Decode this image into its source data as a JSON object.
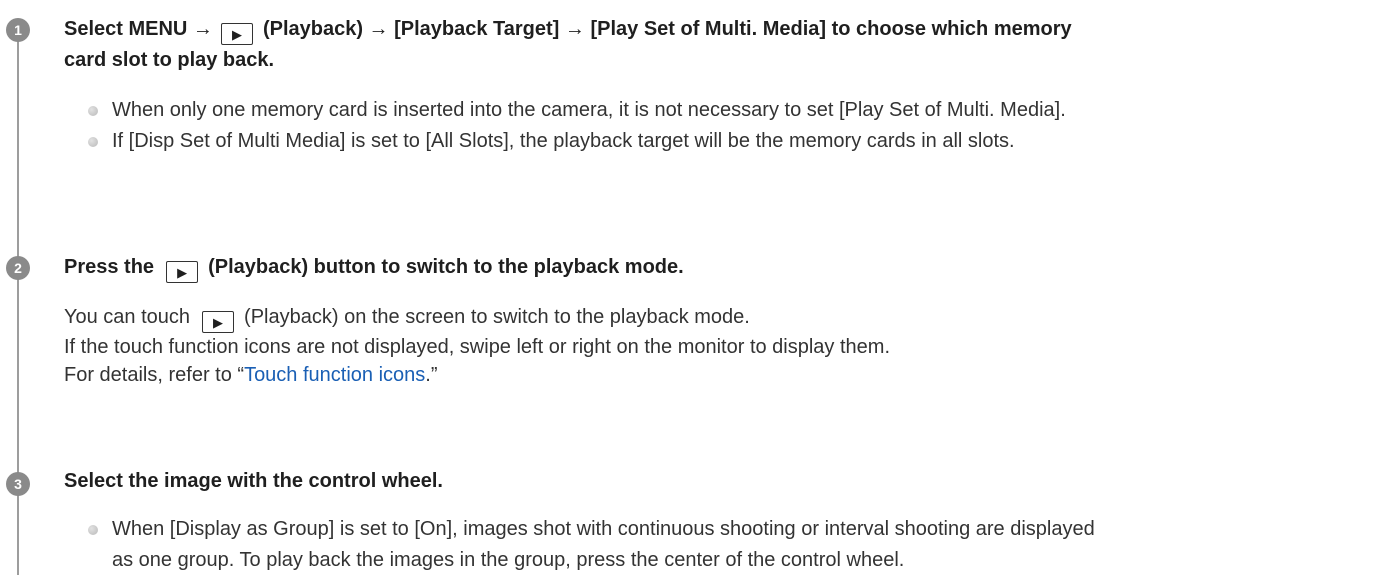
{
  "steps": [
    {
      "number": "1",
      "title_before": "Select MENU →",
      "title_after": "(Playback) → [Playback Target] → [Play Set of Multi. Media] to choose which memory",
      "title_line2": "card slot to play back.",
      "bullets": [
        "When only one memory card is inserted into the camera, it is not necessary to set [Play Set of Multi. Media].",
        "If [Disp Set of Multi Media] is set to [All Slots], the playback target will be the memory cards in all slots."
      ]
    },
    {
      "number": "2",
      "title_before": "Press the",
      "title_after": "(Playback) button to switch to the playback mode.",
      "line1_before": "You can touch",
      "line1_after": "(Playback) on the screen to switch to the playback mode.",
      "line2": "If the touch function icons are not displayed, swipe left or right on the monitor to display them.",
      "line3_before": "For details, refer to “",
      "line3_link": "Touch function icons",
      "line3_after": ".”"
    },
    {
      "number": "3",
      "title": "Select the image with the control wheel.",
      "bullet_line1": "When [Display as Group] is set to [On], images shot with continuous shooting or interval shooting are displayed",
      "bullet_line2": "as one group. To play back the images in the group, press the center of the control wheel."
    }
  ],
  "icons": {
    "playback": "playback-icon",
    "bullet": "bullet-dot-icon"
  },
  "colors": {
    "link": "#1a5fb4",
    "badge": "#8a8a8a",
    "rail": "#9d9d9d"
  }
}
